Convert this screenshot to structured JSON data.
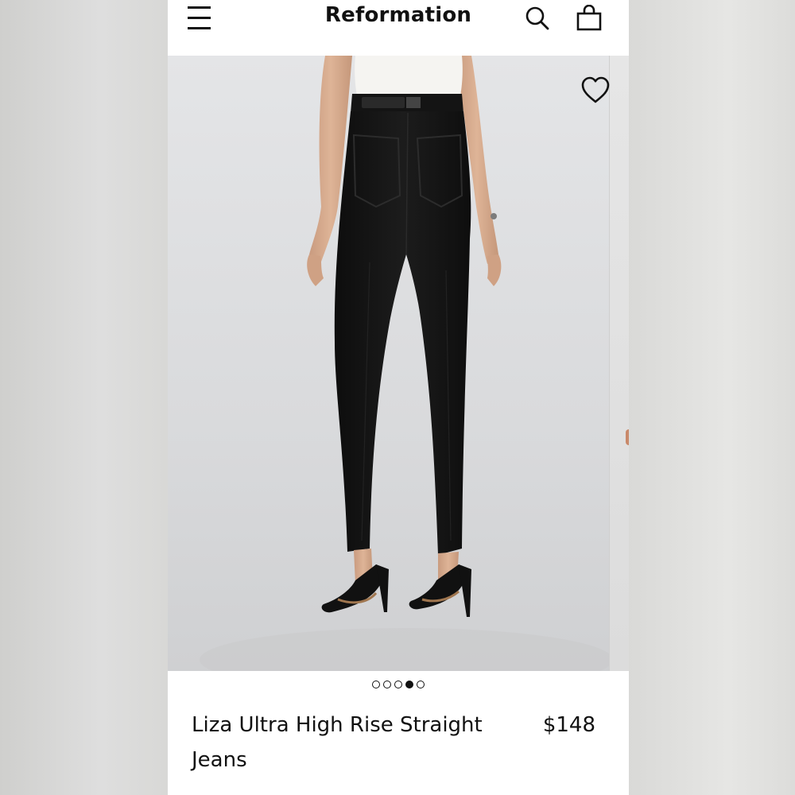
{
  "header": {
    "brand": "Reformation",
    "menu_icon": "hamburger-menu-icon",
    "search_icon": "search-icon",
    "bag_icon": "shopping-bag-icon"
  },
  "gallery": {
    "photo": "product photo: model wearing black straight-leg jeans, rear view, white top, black belt, black strappy heels",
    "wishlist_icon": "heart-outline-icon",
    "slides_total": 5,
    "active_slide": 4
  },
  "product": {
    "name": "Liza Ultra High Rise Straight Jeans",
    "price": "$148"
  },
  "colors": {
    "text": "#111111",
    "background": "#ffffff",
    "photo_backdrop": "#dcdddf",
    "denim": "#141414"
  }
}
